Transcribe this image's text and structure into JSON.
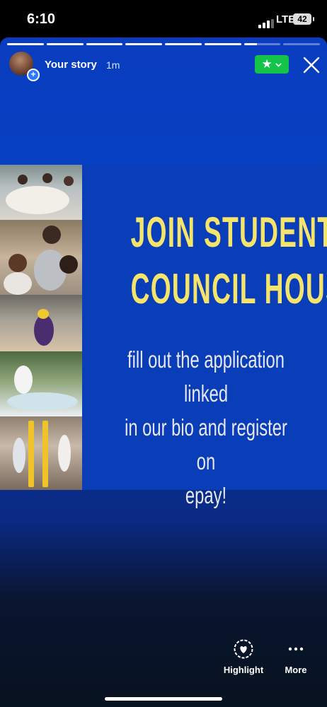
{
  "status_bar": {
    "time": "6:10",
    "network": "LTE",
    "battery": "42"
  },
  "story": {
    "user": "Your story",
    "time_ago": "1m",
    "progress": {
      "segments": 8,
      "completed": 6,
      "current_fraction": 0.35
    },
    "close_friends_icon": "star-icon",
    "headline_lines": [
      "JOIN STUDENT",
      "COUNCIL HOUSE"
    ],
    "body_lines": [
      "fill out the application linked",
      "in our bio and register on",
      "epay!"
    ],
    "colors": {
      "background": "#0a3db8",
      "headline": "#f5e46b",
      "body": "#e8e8f0",
      "close_friends": "#14c44a"
    }
  },
  "actions": [
    {
      "label": "Highlight",
      "icon": "heart-highlight-icon"
    },
    {
      "label": "More",
      "icon": "more-dots-icon"
    }
  ]
}
